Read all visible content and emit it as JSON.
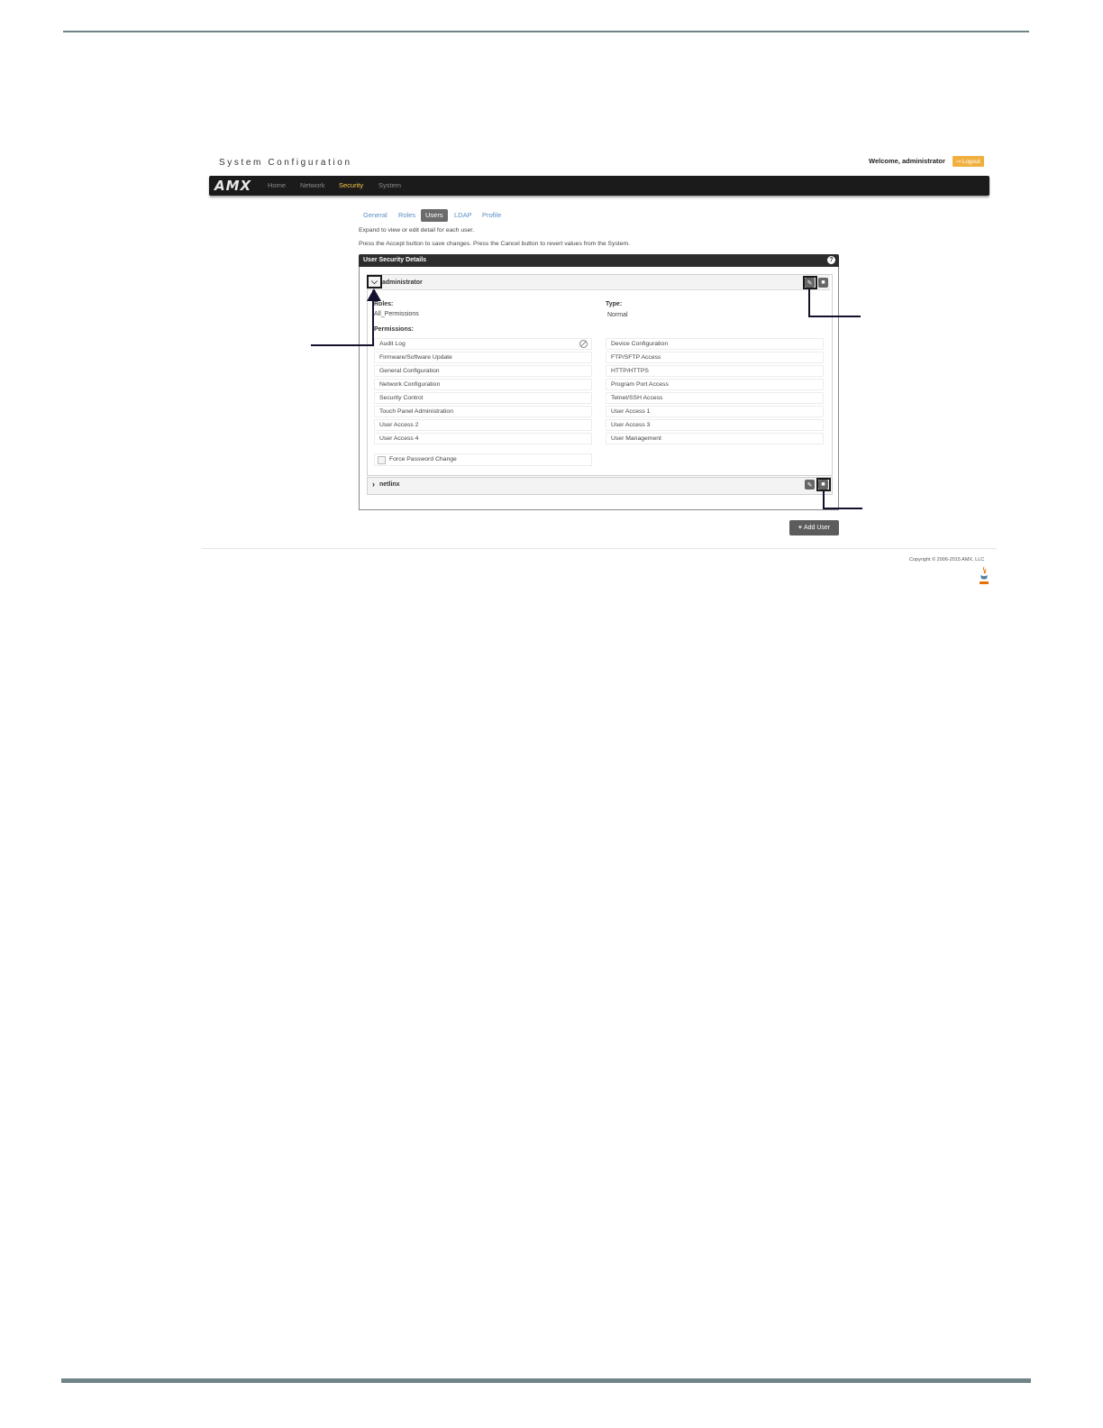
{
  "header": {
    "title": "System Configuration",
    "welcome": "Welcome, administrator",
    "logout_label": "Logout"
  },
  "navbar": {
    "logo": "AMX",
    "items": [
      "Home",
      "Network",
      "Security",
      "System"
    ],
    "active": "Security"
  },
  "subtabs": {
    "items": [
      "General",
      "Roles",
      "Users",
      "LDAP",
      "Profile"
    ],
    "active": "Users"
  },
  "hints": [
    "Expand to view or edit detail for each user.",
    "Press the Accept button to save changes. Press the Cancel button to revert values from the System."
  ],
  "panel": {
    "title": "User Security Details",
    "help": "?"
  },
  "users": [
    {
      "name": "administrator",
      "roles_label": "Roles:",
      "roles_value": "All_Permissions",
      "type_label": "Type:",
      "type_value": "Normal",
      "permissions_label": "Permissions:",
      "permissions_left": [
        "Audit Log",
        "Firmware/Software Update",
        "General Configuration",
        "Network Configuration",
        "Security Control",
        "Touch Panel Administration",
        "User Access 2",
        "User Access 4"
      ],
      "permissions_right": [
        "Device Configuration",
        "FTP/SFTP Access",
        "HTTP/HTTPS",
        "Program Port Access",
        "Telnet/SSH Access",
        "User Access 1",
        "User Access 3",
        "User Management"
      ],
      "force_password_label": "Force Password Change"
    },
    {
      "name": "netlinx"
    }
  ],
  "add_user_label": "Add User",
  "footer": {
    "copyright": "Copyright © 2006-2015 AMX, LLC"
  },
  "colors": {
    "navbar": "#1b1b1b",
    "nav_active": "#f6c644",
    "logout": "#f0b040",
    "link": "#5a8fc4",
    "rule": "#6f8487"
  }
}
